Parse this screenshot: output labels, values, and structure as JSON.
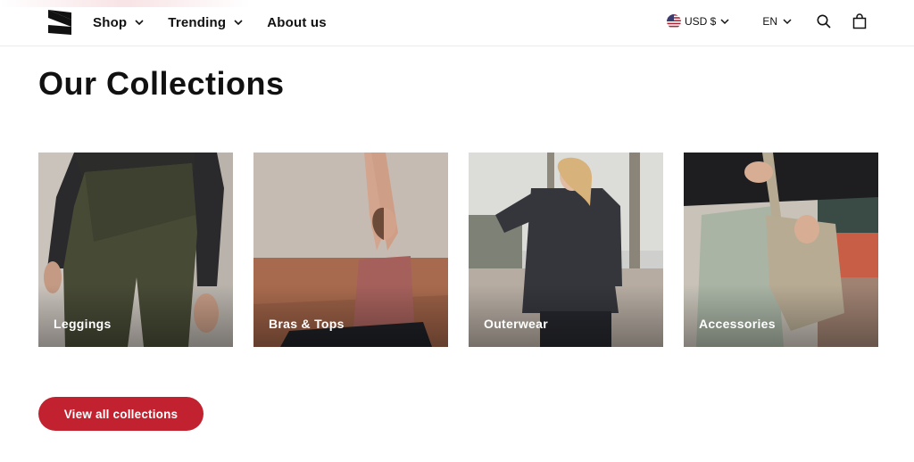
{
  "header": {
    "logo_icon": "brand-s-logo",
    "nav": [
      {
        "label": "Shop",
        "icon": "chevron-down-icon"
      },
      {
        "label": "Trending",
        "icon": "chevron-down-icon"
      },
      {
        "label": "About us",
        "icon": null
      }
    ],
    "currency": {
      "label": "USD $",
      "icon": "us-flag-icon"
    },
    "language": {
      "label": "EN"
    },
    "icons": [
      "search-icon",
      "shopping-bag-icon"
    ]
  },
  "main": {
    "title": "Our Collections",
    "collections": [
      {
        "label": "Leggings",
        "image": "woman in olive leggings and black top"
      },
      {
        "label": "Bras & Tops",
        "image": "woman stretching in rust sports top"
      },
      {
        "label": "Outerwear",
        "image": "woman in charcoal half-zip pullover"
      },
      {
        "label": "Accessories",
        "image": "sage joggers with canvas bag"
      }
    ],
    "cta_label": "View all collections"
  },
  "colors": {
    "accent": "#c2222f",
    "text": "#111111",
    "background": "#ffffff"
  }
}
